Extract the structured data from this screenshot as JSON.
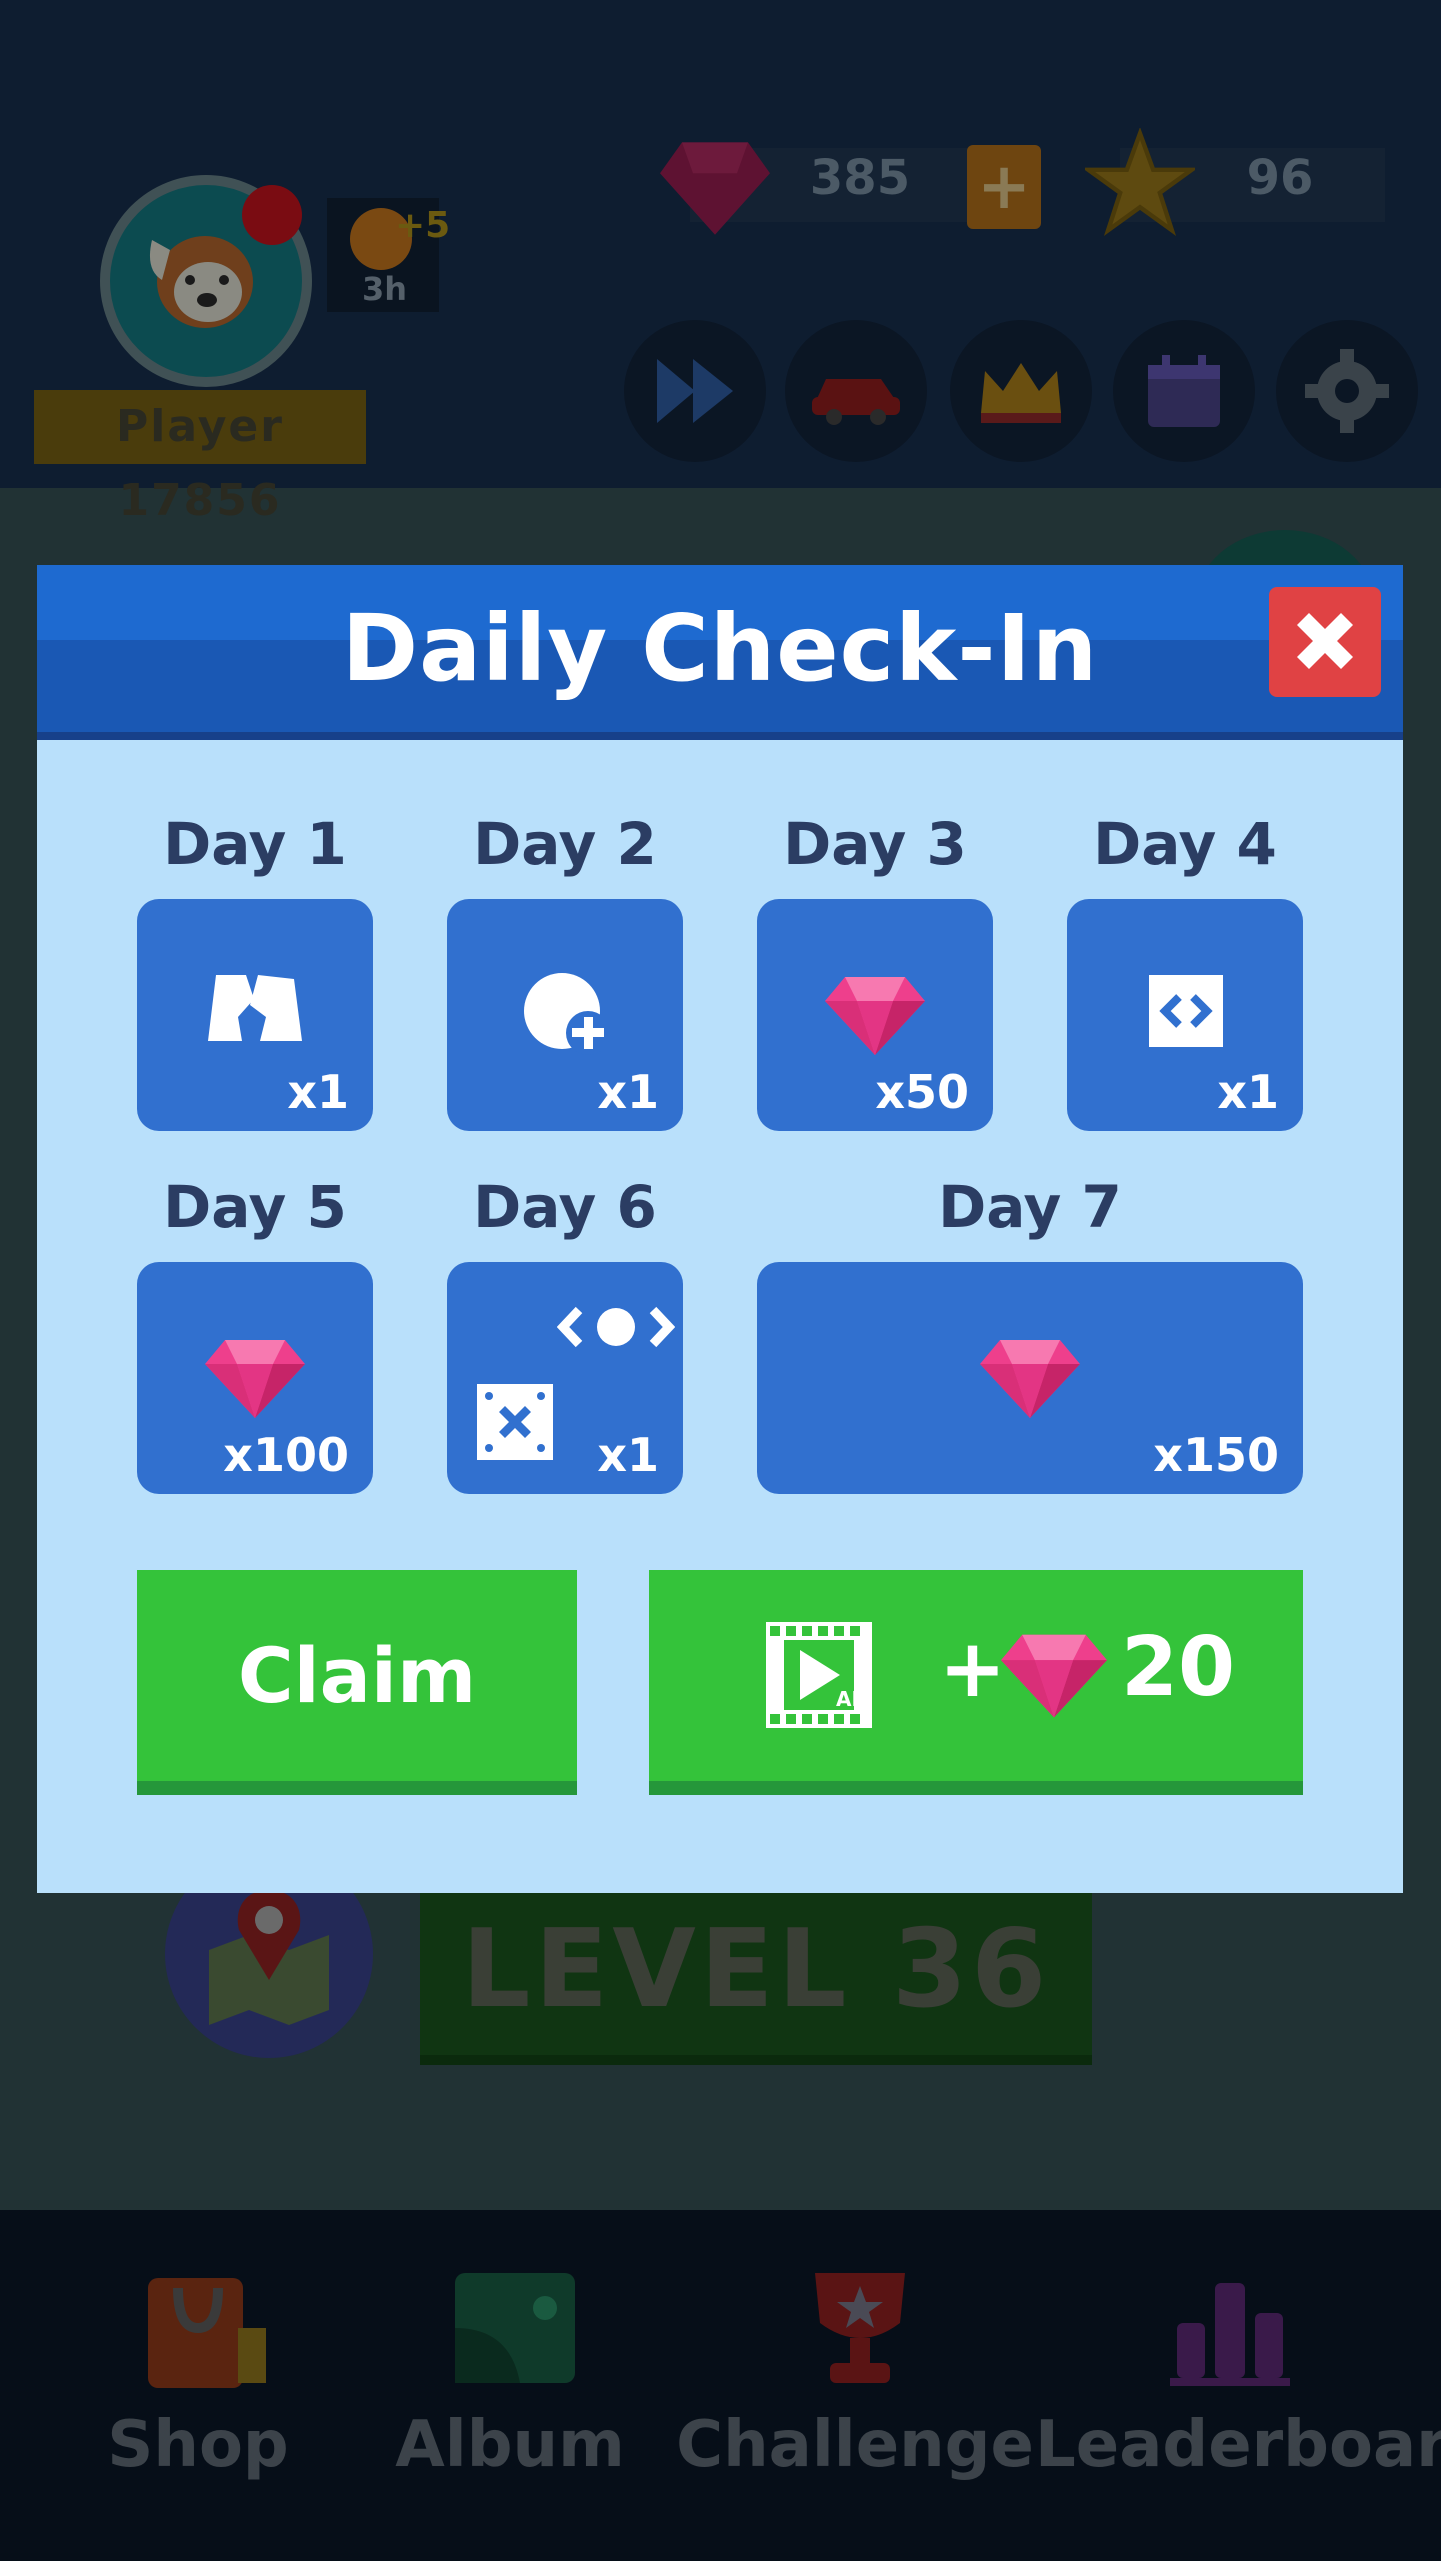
{
  "header": {
    "player_name": "Player 17856",
    "energy": {
      "bonus": "+5",
      "timer": "3h"
    },
    "gems": "385",
    "stars": "96"
  },
  "toolbar": {
    "buttons": [
      "fast-forward-icon",
      "car-icon",
      "crown-icon",
      "calendar-icon",
      "gear-icon"
    ]
  },
  "main": {
    "level_label": "LEVEL 36"
  },
  "nav": {
    "items": [
      {
        "label": "Shop",
        "icon": "shopping-bag-icon"
      },
      {
        "label": "Album",
        "icon": "album-icon"
      },
      {
        "label": "Challenge",
        "icon": "trophy-icon"
      },
      {
        "label": "Leaderboard",
        "icon": "bar-chart-icon"
      }
    ]
  },
  "modal": {
    "title": "Daily Check-In",
    "days": [
      {
        "label": "Day 1",
        "reward": "ticket-icon",
        "qty": "x1"
      },
      {
        "label": "Day 2",
        "reward": "token-plus-icon",
        "qty": "x1"
      },
      {
        "label": "Day 3",
        "reward": "gem-icon",
        "qty": "x50"
      },
      {
        "label": "Day 4",
        "reward": "code-box-icon",
        "qty": "x1"
      },
      {
        "label": "Day 5",
        "reward": "gem-icon",
        "qty": "x100"
      },
      {
        "label": "Day 6",
        "reward": "eye-dice-icon",
        "qty": "x1"
      },
      {
        "label": "Day 7",
        "reward": "gem-icon",
        "qty": "x150"
      }
    ],
    "claim_label": "Claim",
    "ad_bonus": {
      "plus": "+",
      "amount": "20",
      "ad_tag": "AD"
    }
  },
  "colors": {
    "modal_bg": "#b9e0fb",
    "header_blue": "#1e6ad0",
    "tile_blue": "#3170cf",
    "claim_green": "#34c33a",
    "close_red": "#e04244",
    "gem_pink": "#ee3f8c"
  }
}
